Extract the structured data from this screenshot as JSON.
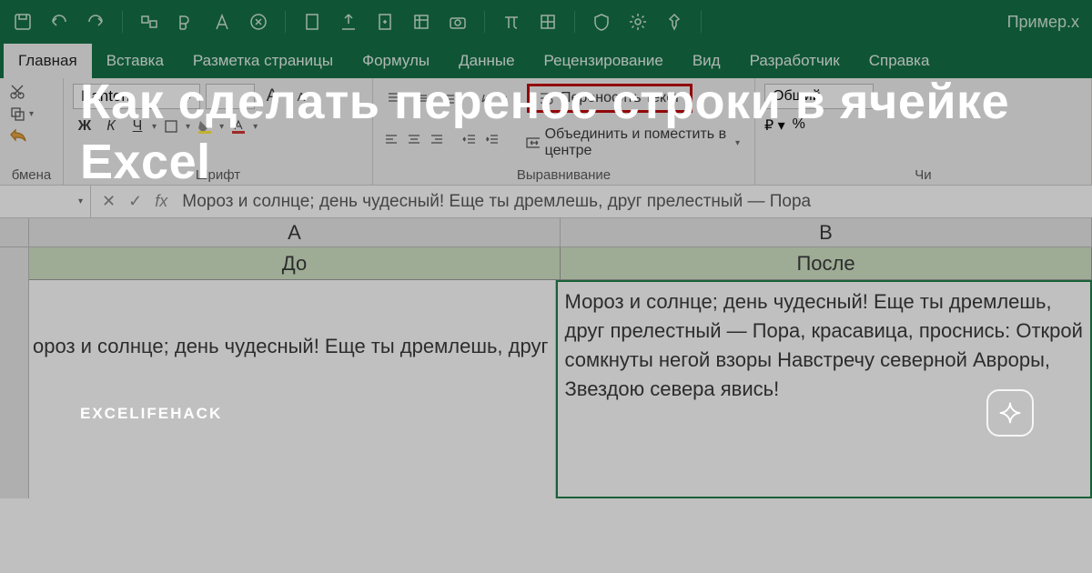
{
  "qat_right": "Пример.х",
  "tabs": [
    "Главная",
    "Вставка",
    "Разметка страницы",
    "Формулы",
    "Данные",
    "Рецензирование",
    "Вид",
    "Разработчик",
    "Справка"
  ],
  "ribbon": {
    "clipboard_label": "бмена",
    "font": {
      "name": "Panton",
      "label": "Шрифт",
      "btn_bold": "Ж",
      "btn_italic": "К",
      "btn_underline": "Ч",
      "big_a": "A",
      "small_a": "A"
    },
    "align": {
      "label": "Выравнивание",
      "wrap": "Переносить текст",
      "merge": "Объединить и поместить в центре"
    },
    "number": {
      "label": "Чи",
      "format": "Общий",
      "percent": "%"
    }
  },
  "formula_bar": {
    "fx": "fx",
    "value": "Мороз и солнце; день чудесный! Еще ты дремлешь, друг прелестный — Пора"
  },
  "sheet": {
    "colA": "A",
    "colB": "B",
    "hdrA": "До",
    "hdrB": "После",
    "cellA": "ороз и солнце; день чудесный! Еще ты дремлешь, друг п",
    "cellB": "Мороз и солнце; день чудесный! Еще ты дремлешь, друг прелестный — Пора, красавица, проснись: Открой сомкнуты негой взоры Навстречу северной Авроры, Звездою севера явись!"
  },
  "overlay": {
    "title": "Как сделать перенос строки в ячейке Excel",
    "brand": "EXCELIFEHACK"
  }
}
